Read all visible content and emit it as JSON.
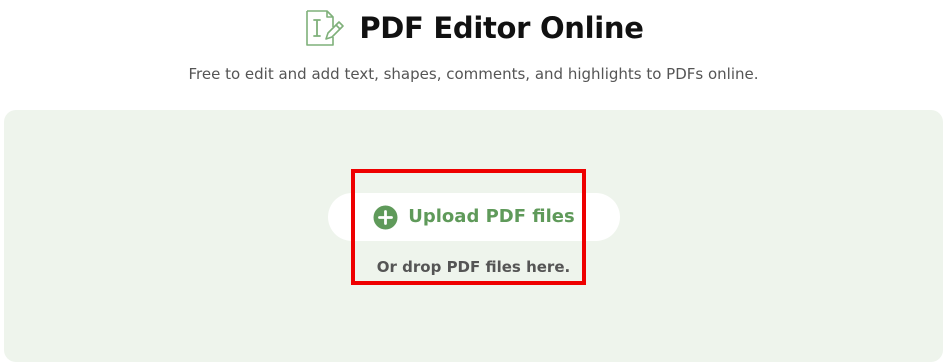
{
  "header": {
    "title": "PDF Editor Online",
    "subtitle": "Free to edit and add text, shapes, comments, and highlights to PDFs online.",
    "logo_icon": "pdf-edit-icon"
  },
  "upload": {
    "button_label": "Upload PDF files",
    "button_icon": "plus-circle-icon",
    "drop_hint": "Or drop PDF files here."
  },
  "colors": {
    "accent": "#5f9a5a",
    "drop_zone_background": "#eef4ec",
    "highlight": "#ee0000",
    "title_text": "#111111",
    "muted_text": "#555555"
  }
}
